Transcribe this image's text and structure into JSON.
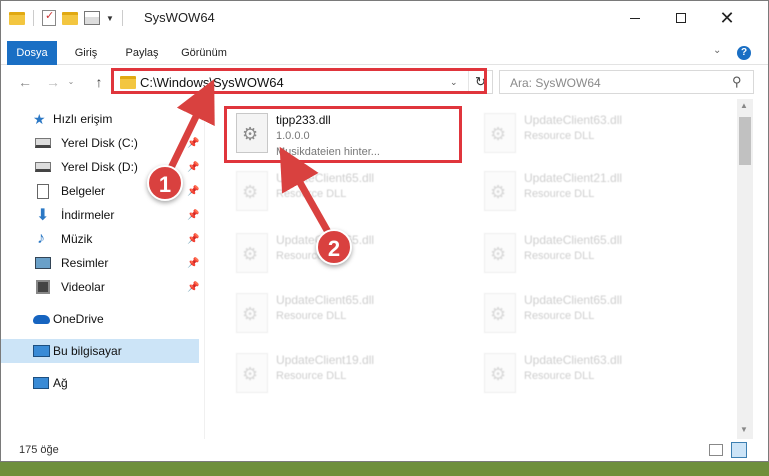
{
  "window": {
    "title": "SysWOW64"
  },
  "ribbon": {
    "tabs": [
      "Dosya",
      "Giriş",
      "Paylaş",
      "Görünüm"
    ]
  },
  "navigation": {
    "address": "C:\\Windows\\SysWOW64",
    "search_placeholder": "Ara: SysWOW64"
  },
  "sidebar": {
    "items": [
      {
        "label": "Hızlı erişim",
        "icon": "star-icon"
      },
      {
        "label": "Yerel Disk (C:)",
        "icon": "drive-icon",
        "pinned": true
      },
      {
        "label": "Yerel Disk (D:)",
        "icon": "drive-icon",
        "pinned": true
      },
      {
        "label": "Belgeler",
        "icon": "document-icon",
        "pinned": true
      },
      {
        "label": "İndirmeler",
        "icon": "download-icon",
        "pinned": true
      },
      {
        "label": "Müzik",
        "icon": "music-icon",
        "pinned": true
      },
      {
        "label": "Resimler",
        "icon": "pictures-icon",
        "pinned": true
      },
      {
        "label": "Videolar",
        "icon": "video-icon",
        "pinned": true
      },
      {
        "label": "OneDrive",
        "icon": "onedrive-icon"
      },
      {
        "label": "Bu bilgisayar",
        "icon": "computer-icon",
        "selected": true
      },
      {
        "label": "Ağ",
        "icon": "network-icon"
      }
    ]
  },
  "files": [
    {
      "name": "tipp233.dll",
      "version": "1.0.0.0",
      "desc": "Musikdateien hinter..."
    },
    {
      "name": "UpdateClient63.dll",
      "desc": "Resource DLL"
    },
    {
      "name": "UpdateClient65.dll",
      "desc": "Resource DLL"
    },
    {
      "name": "UpdateClient21.dll",
      "desc": "Resource DLL"
    },
    {
      "name": "UpdateClient65.dll",
      "desc": "Resource DLL"
    },
    {
      "name": "UpdateClient65.dll",
      "desc": "Resource DLL"
    },
    {
      "name": "UpdateClient65.dll",
      "desc": "Resource DLL"
    },
    {
      "name": "UpdateClient65.dll",
      "desc": "Resource DLL"
    },
    {
      "name": "UpdateClient19.dll",
      "desc": "Resource DLL"
    },
    {
      "name": "UpdateClient63.dll",
      "desc": "Resource DLL"
    }
  ],
  "status": {
    "item_count": "175 öğe"
  },
  "annotations": {
    "step1": "1",
    "step2": "2",
    "highlight_color": "#e0353c",
    "badge_color": "#d9413f"
  },
  "colors": {
    "accent": "#1a6fc4",
    "selection": "#cce4f7"
  }
}
